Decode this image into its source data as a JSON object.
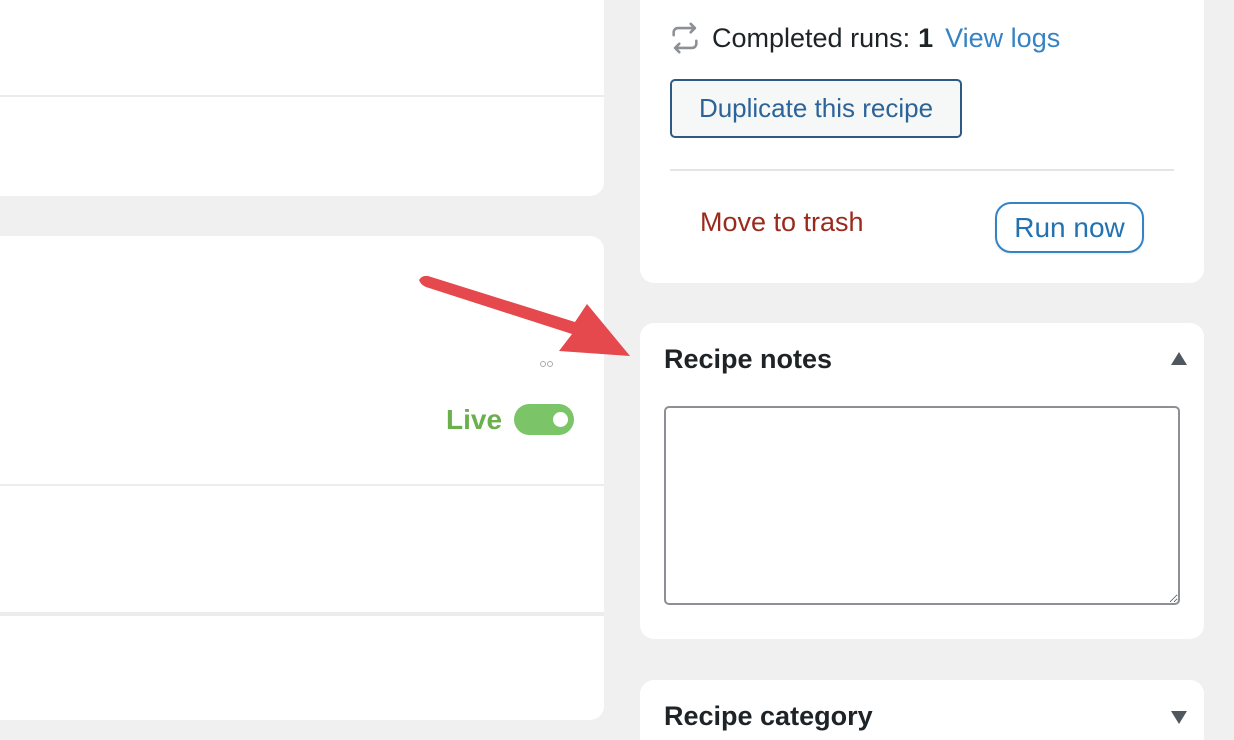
{
  "publish": {
    "runs_label": "Completed runs:",
    "runs_count": "1",
    "view_logs": "View logs",
    "duplicate_label": "Duplicate this recipe",
    "trash_label": "Move to trash",
    "run_now_label": "Run now"
  },
  "recipe_status": {
    "label": "Live",
    "enabled": true
  },
  "notes": {
    "title": "Recipe notes",
    "value": ""
  },
  "category": {
    "title": "Recipe category"
  },
  "colors": {
    "accent": "#2271b1",
    "live": "#6ab04c",
    "toggle": "#7bc467",
    "danger": "#9b2a1c",
    "annotation_arrow": "#e5484d"
  },
  "icons": {
    "runs": "loop-icon",
    "notes_collapse": "triangle-up-icon",
    "category_expand": "triangle-down-icon"
  }
}
